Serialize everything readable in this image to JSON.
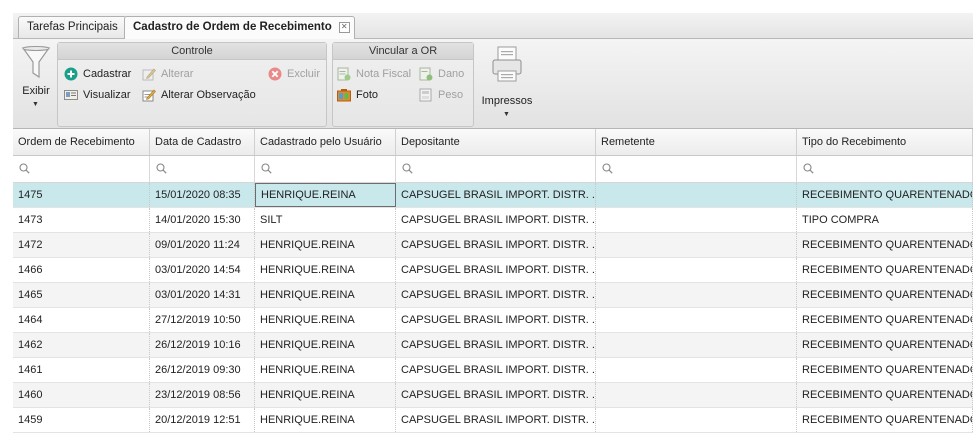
{
  "tabs": [
    {
      "label": "Tarefas Principais"
    },
    {
      "label": "Cadastro de Ordem de Recebimento"
    }
  ],
  "toolbar": {
    "exibir": "Exibir",
    "controle": {
      "title": "Controle",
      "cadastrar": "Cadastrar",
      "alterar": "Alterar",
      "excluir": "Excluir",
      "visualizar": "Visualizar",
      "alterar_observacao": "Alterar Observação"
    },
    "vincular": {
      "title": "Vincular a OR",
      "nota_fiscal": "Nota Fiscal",
      "dano": "Dano",
      "foto": "Foto",
      "peso": "Peso"
    },
    "impressos": "Impressos"
  },
  "grid": {
    "columns": [
      "Ordem de Recebimento",
      "Data de Cadastro",
      "Cadastrado pelo Usuário",
      "Depositante",
      "Remetente",
      "Tipo do Recebimento"
    ],
    "rows": [
      [
        "1475",
        "15/01/2020 08:35",
        "HENRIQUE.REINA",
        "CAPSUGEL BRASIL IMPORT. DISTR. ...",
        "",
        "RECEBIMENTO QUARENTENADO"
      ],
      [
        "1473",
        "14/01/2020 15:30",
        "SILT",
        "CAPSUGEL BRASIL IMPORT. DISTR. ...",
        "",
        "TIPO COMPRA"
      ],
      [
        "1472",
        "09/01/2020 11:24",
        "HENRIQUE.REINA",
        "CAPSUGEL BRASIL IMPORT. DISTR. ...",
        "",
        "RECEBIMENTO QUARENTENADO"
      ],
      [
        "1466",
        "03/01/2020 14:54",
        "HENRIQUE.REINA",
        "CAPSUGEL BRASIL IMPORT. DISTR. ...",
        "",
        "RECEBIMENTO QUARENTENADO"
      ],
      [
        "1465",
        "03/01/2020 14:31",
        "HENRIQUE.REINA",
        "CAPSUGEL BRASIL IMPORT. DISTR. ...",
        "",
        "RECEBIMENTO QUARENTENADO"
      ],
      [
        "1464",
        "27/12/2019 10:50",
        "HENRIQUE.REINA",
        "CAPSUGEL BRASIL IMPORT. DISTR. ...",
        "",
        "RECEBIMENTO QUARENTENADO"
      ],
      [
        "1462",
        "26/12/2019 10:16",
        "HENRIQUE.REINA",
        "CAPSUGEL BRASIL IMPORT. DISTR. ...",
        "",
        "RECEBIMENTO QUARENTENADO"
      ],
      [
        "1461",
        "26/12/2019 09:30",
        "HENRIQUE.REINA",
        "CAPSUGEL BRASIL IMPORT. DISTR. ...",
        "",
        "RECEBIMENTO QUARENTENADO"
      ],
      [
        "1460",
        "23/12/2019 08:56",
        "HENRIQUE.REINA",
        "CAPSUGEL BRASIL IMPORT. DISTR. ...",
        "",
        "RECEBIMENTO QUARENTENADO"
      ],
      [
        "1459",
        "20/12/2019 12:51",
        "HENRIQUE.REINA",
        "CAPSUGEL BRASIL IMPORT. DISTR. ...",
        "",
        "RECEBIMENTO QUARENTENADO"
      ]
    ]
  },
  "colors": {
    "selected_row": "#c9e8ec",
    "add_icon": "#1aa08a",
    "delete_icon": "#e06060"
  }
}
